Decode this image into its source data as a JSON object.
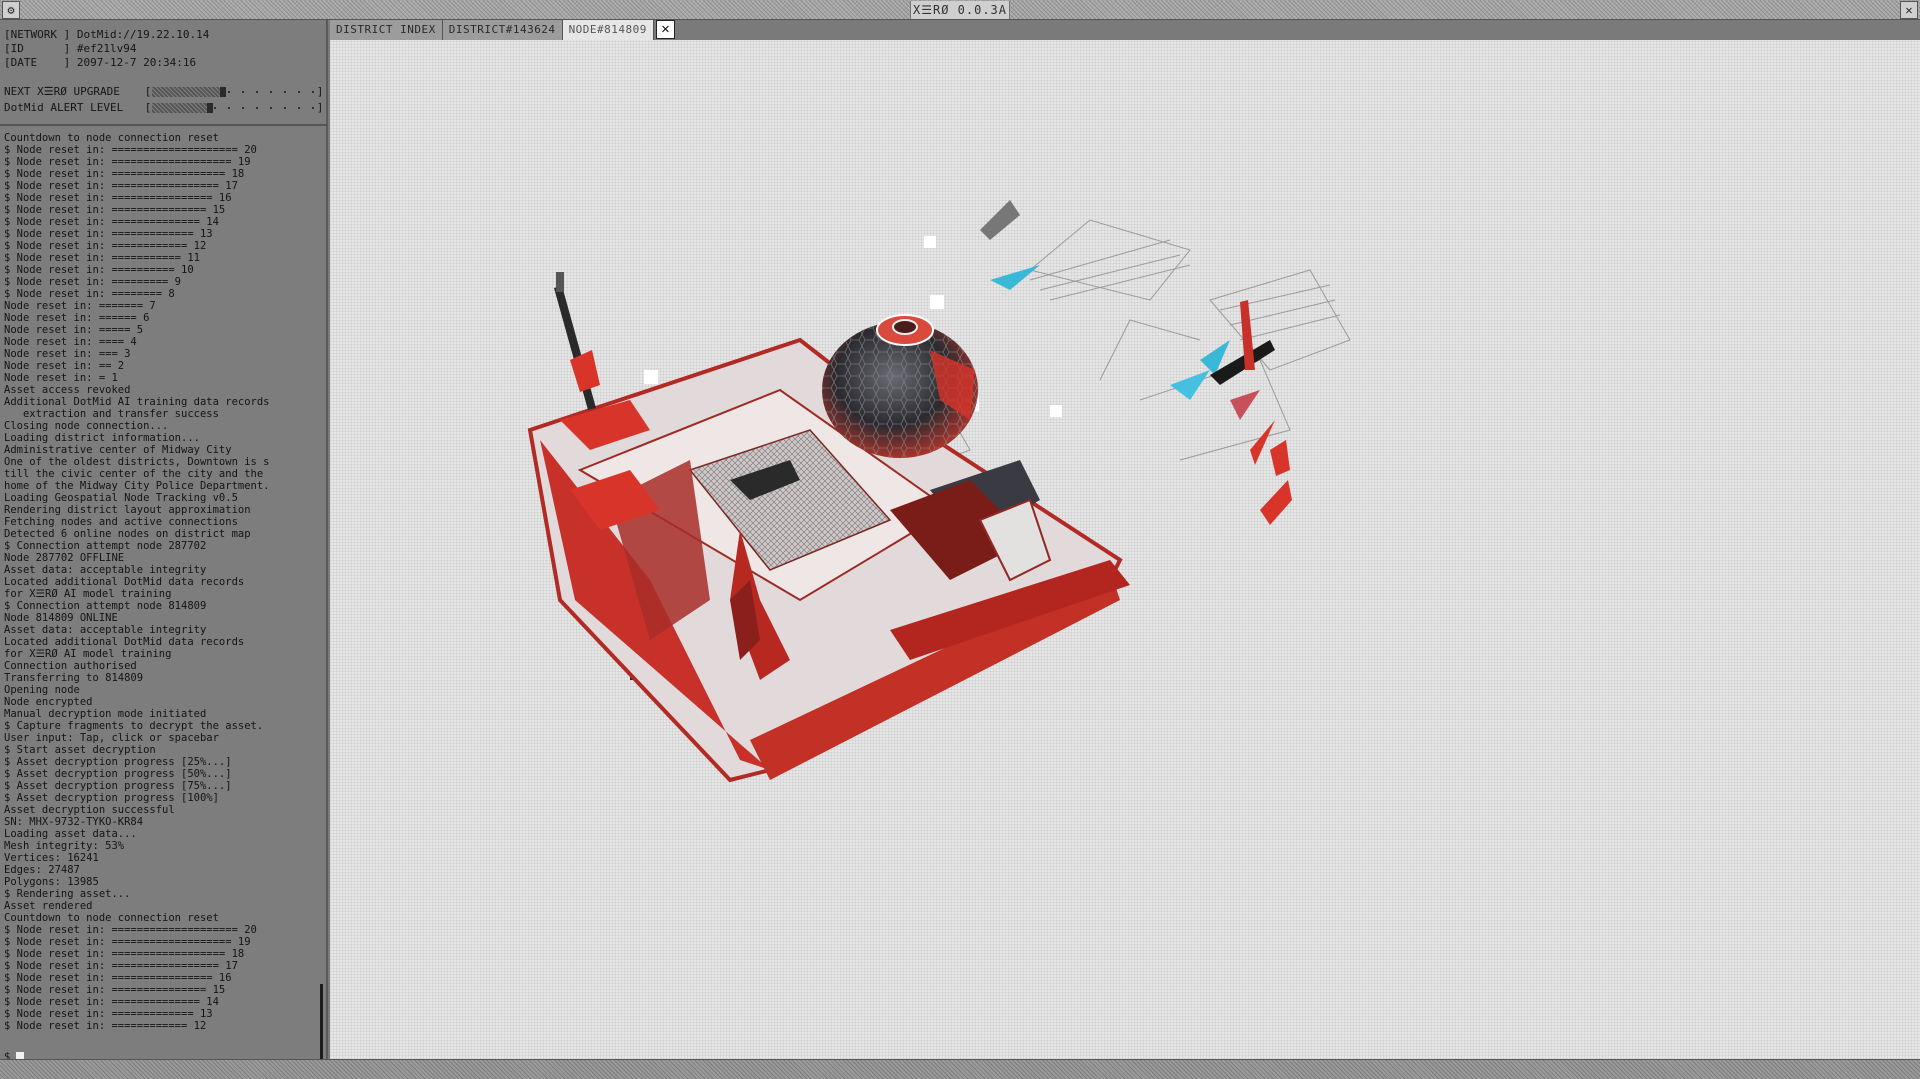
{
  "window": {
    "title": "X☰RØ 0.0.3A",
    "settings_icon": "gear-icon",
    "close_icon": "close-icon"
  },
  "info": {
    "network_label": "[NETWORK ]",
    "network_value": "DotMid://19.22.10.14",
    "id_label": "[ID      ]",
    "id_value": "#ef21lv94",
    "date_label": "[DATE    ]",
    "date_value": "2097-12-7 20:34:16"
  },
  "meters": [
    {
      "label": "NEXT X☰RØ UPGRADE",
      "fill_fraction": 0.45
    },
    {
      "label": "DotMid ALERT LEVEL",
      "fill_fraction": 0.37
    }
  ],
  "console": {
    "lines": [
      "Countdown to node connection reset",
      "$ Node reset in: ==================== 20",
      "$ Node reset in: =================== 19",
      "$ Node reset in: ================== 18",
      "$ Node reset in: ================= 17",
      "$ Node reset in: ================ 16",
      "$ Node reset in: =============== 15",
      "$ Node reset in: ============== 14",
      "$ Node reset in: ============= 13",
      "$ Node reset in: ============ 12",
      "$ Node reset in: =========== 11",
      "$ Node reset in: ========== 10",
      "$ Node reset in: ========= 9",
      "$ Node reset in: ======== 8",
      "Node reset in: ======= 7",
      "Node reset in: ====== 6",
      "Node reset in: ===== 5",
      "Node reset in: ==== 4",
      "Node reset in: === 3",
      "Node reset in: == 2",
      "Node reset in: = 1",
      "Asset access revoked",
      "Additional DotMid AI training data records",
      "   extraction and transfer success",
      "Closing node connection...",
      "Loading district information...",
      "Administrative center of Midway City",
      "One of the oldest districts, Downtown is s",
      "till the civic center of the city and the",
      "home of the Midway City Police Department.",
      "Loading Geospatial Node Tracking v0.5",
      "Rendering district layout approximation",
      "Fetching nodes and active connections",
      "Detected 6 online nodes on district map",
      "$ Connection attempt node 287702",
      "Node 287702 OFFLINE",
      "Asset data: acceptable integrity",
      "Located additional DotMid data records",
      "for X☰RØ AI model training",
      "$ Connection attempt node 814809",
      "Node 814809 ONLINE",
      "Asset data: acceptable integrity",
      "Located additional DotMid data records",
      "for X☰RØ AI model training",
      "Connection authorised",
      "Transferring to 814809",
      "Opening node",
      "Node encrypted",
      "Manual decryption mode initiated",
      "$ Capture fragments to decrypt the asset.",
      "User input: Tap, click or spacebar",
      "$ Start asset decryption",
      "$ Asset decryption progress [25%...]",
      "$ Asset decryption progress [50%...]",
      "$ Asset decryption progress [75%...]",
      "$ Asset decryption progress [100%]",
      "Asset decryption successful",
      "SN: MHX-9732-TYKO-KR84",
      "Loading asset data...",
      "Mesh integrity: 53%",
      "Vertices: 16241",
      "Edges: 27487",
      "Polygons: 13985",
      "$ Rendering asset...",
      "Asset rendered",
      "Countdown to node connection reset",
      "$ Node reset in: ==================== 20",
      "$ Node reset in: =================== 19",
      "$ Node reset in: ================== 18",
      "$ Node reset in: ================= 17",
      "$ Node reset in: ================ 16",
      "$ Node reset in: =============== 15",
      "$ Node reset in: ============== 14",
      "$ Node reset in: ============= 13",
      "$ Node reset in: ============ 12"
    ],
    "prompt": "$"
  },
  "tabs": [
    {
      "label": "DISTRICT INDEX",
      "active": false
    },
    {
      "label": "DISTRICT#143624",
      "active": false
    },
    {
      "label": "NODE#814809",
      "active": true
    }
  ],
  "tab_close_icon": "close-icon",
  "viewport": {
    "background_color": "#e6e6e6",
    "accent_color": "#d8342a"
  }
}
